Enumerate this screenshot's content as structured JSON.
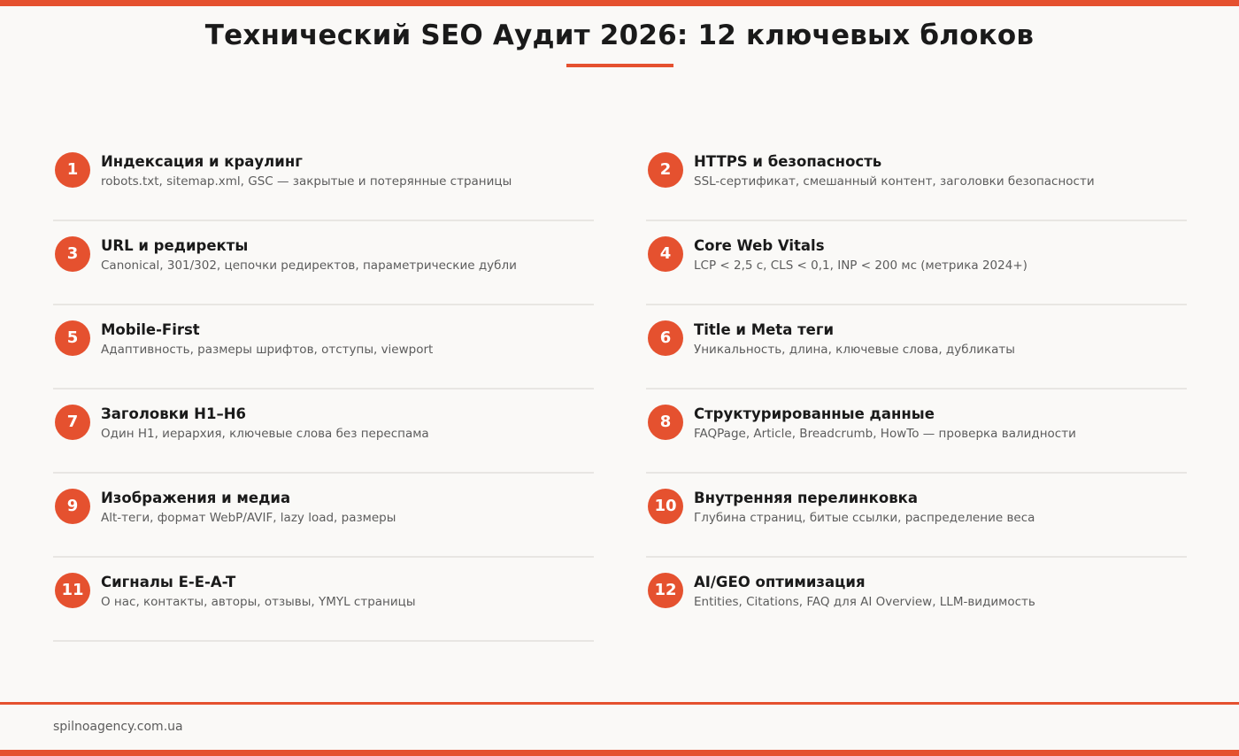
{
  "title": "Технический SEO Аудит 2026: 12 ключевых блоков",
  "accent_color": "#e5512f",
  "left_items": [
    {
      "num": "1",
      "title": "Индексация и краулинг",
      "desc": "robots.txt, sitemap.xml, GSC — закрытые и потерянные страницы"
    },
    {
      "num": "3",
      "title": "URL и редиректы",
      "desc": "Canonical, 301/302, цепочки редиректов, параметрические дубли"
    },
    {
      "num": "5",
      "title": "Mobile-First",
      "desc": "Адаптивность, размеры шрифтов, отступы, viewport"
    },
    {
      "num": "7",
      "title": "Заголовки H1–H6",
      "desc": "Один H1, иерархия, ключевые слова без переспама"
    },
    {
      "num": "9",
      "title": "Изображения и медиа",
      "desc": "Alt-теги, формат WebP/AVIF, lazy load, размеры"
    },
    {
      "num": "11",
      "title": "Сигналы E-E-A-T",
      "desc": "О нас, контакты, авторы, отзывы, YMYL страницы"
    }
  ],
  "right_items": [
    {
      "num": "2",
      "title": "HTTPS и безопасность",
      "desc": "SSL-сертификат, смешанный контент, заголовки безопасности"
    },
    {
      "num": "4",
      "title": "Core Web Vitals",
      "desc": "LCP < 2,5 с, CLS < 0,1, INP < 200 мс (метрика 2024+)"
    },
    {
      "num": "6",
      "title": "Title и Meta теги",
      "desc": "Уникальность, длина, ключевые слова, дубликаты"
    },
    {
      "num": "8",
      "title": "Структурированные данные",
      "desc": "FAQPage, Article, Breadcrumb, HowTo — проверка валидности"
    },
    {
      "num": "10",
      "title": "Внутренняя перелинковка",
      "desc": "Глубина страниц, битые ссылки, распределение веса"
    },
    {
      "num": "12",
      "title": "AI/GEO оптимизация",
      "desc": "Entities, Citations, FAQ для AI Overview, LLM-видимость"
    }
  ],
  "footer": {
    "site": "spilnoagency.com.ua"
  }
}
